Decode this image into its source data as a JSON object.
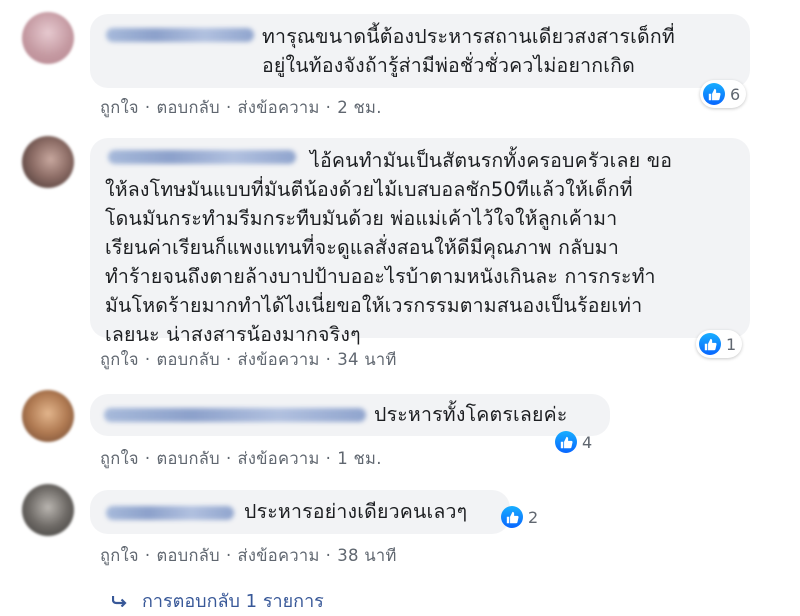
{
  "comments": [
    {
      "text": "ทารุณขนาดนี้ต้องประหารสถานเดียวสงสารเด็กที่\nอยู่ในท้องจังถ้ารู้ส่ามีพ่อชั่วชั่วควไม่อยากเกิด",
      "actions": {
        "like": "ถูกใจ",
        "reply": "ตอบกลับ",
        "message": "ส่งข้อความ",
        "time": "2 ชม."
      },
      "reactions": "6",
      "avatar_color": "#c9a8ad"
    },
    {
      "text": "ไอ้คนทำมันเป็นสัตนรกทั้งครอบครัวเลย ขอ\nให้ลงโทษมันแบบที่มันตีน้องด้วยไม้เบสบอลชัก50ทีแล้วให้เด็กที่\nโดนมันกระทำมรีมกระทืบมันด้วย พ่อแม่เค้าไว้ใจให้ลูกเค้ามา\nเรียนค่าเรียนก็แพงแทนที่จะดูแลสั่งสอนให้ดีมีคุณภาพ กลับมา\nทำร้ายจนถึงตายล้างบาปป้าบออะไรบ้าตามหนังเกินละ การกระทำ\nมันโหดร้ายมากทำได้ไงเนี่ยขอให้เวรกรรมตามสนองเป็นร้อยเท่า\nเลยนะ น่าสงสารน้องมากจริงๆ",
      "actions": {
        "like": "ถูกใจ",
        "reply": "ตอบกลับ",
        "message": "ส่งข้อความ",
        "time": "34 นาที"
      },
      "reactions": "1",
      "avatar_color": "#8a6f6a"
    },
    {
      "text": "ประหารทั้งโคตรเลยค่ะ",
      "actions": {
        "like": "ถูกใจ",
        "reply": "ตอบกลับ",
        "message": "ส่งข้อความ",
        "time": "1 ชม."
      },
      "reactions": "4",
      "avatar_color": "#b07a52"
    },
    {
      "text": "ประหารอย่างเดียวคนเลวๆ",
      "actions": {
        "like": "ถูกใจ",
        "reply": "ตอบกลับ",
        "message": "ส่งข้อความ",
        "time": "38 นาที"
      },
      "reactions": "2",
      "avatar_color": "#6e6a66"
    }
  ],
  "view_replies": {
    "icon": "reply-arrow-icon",
    "label": "การตอบกลับ 1 รายการ"
  },
  "colors": {
    "bubble": "#f2f3f5",
    "link": "#385898",
    "meta": "#606770",
    "like_blue": "#1877f2"
  }
}
